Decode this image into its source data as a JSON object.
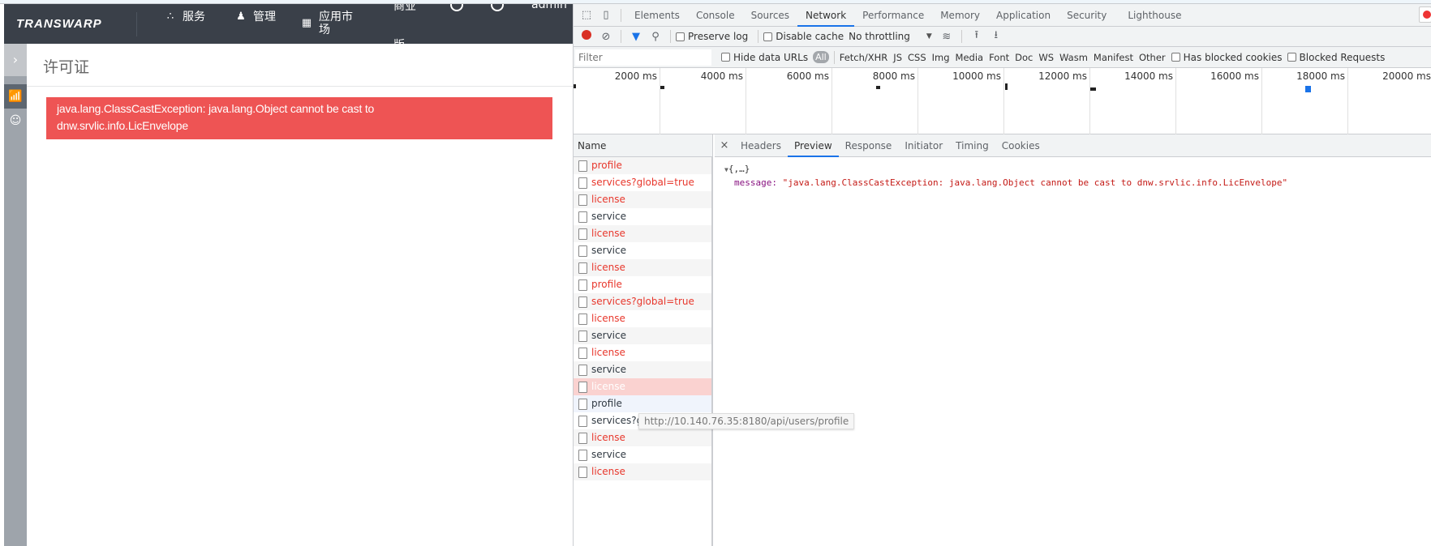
{
  "page": {
    "logo": "TRANSWARP",
    "nav": [
      {
        "icon": "services-icon",
        "glyph": "∴",
        "label": "服务"
      },
      {
        "icon": "user-icon",
        "glyph": "♟",
        "label": "管理"
      },
      {
        "icon": "app-market-icon",
        "glyph": "▦",
        "label": "应用市场"
      }
    ],
    "header_cut_top": "商业",
    "header_cut_bottom": "版",
    "user": "admin",
    "sidebar_expand": "›",
    "page_title": "许可证",
    "alert_line1": "java.lang.ClassCastException: java.lang.Object cannot be cast to",
    "alert_line2": "dnw.srvlic.info.LicEnvelope",
    "alert_color": "#ee5454"
  },
  "devtools": {
    "tabs": [
      "Elements",
      "Console",
      "Sources",
      "Network",
      "Performance",
      "Memory",
      "Application",
      "Security",
      "Lighthouse"
    ],
    "active_tab": "Network",
    "toolbar": {
      "preserve_log": "Preserve log",
      "disable_cache": "Disable cache",
      "throttling": "No throttling"
    },
    "filter": {
      "placeholder": "Filter",
      "hide_data_urls": "Hide data URLs",
      "all": "All",
      "types": [
        "Fetch/XHR",
        "JS",
        "CSS",
        "Img",
        "Media",
        "Font",
        "Doc",
        "WS",
        "Wasm",
        "Manifest",
        "Other"
      ],
      "has_blocked_cookies": "Has blocked cookies",
      "blocked_requests": "Blocked Requests"
    },
    "overview_ticks": [
      "2000 ms",
      "4000 ms",
      "6000 ms",
      "8000 ms",
      "10000 ms",
      "12000 ms",
      "14000 ms",
      "16000 ms",
      "18000 ms",
      "20000 ms"
    ],
    "name_header": "Name",
    "requests": [
      {
        "name": "profile",
        "error": true
      },
      {
        "name": "services?global=true",
        "error": true
      },
      {
        "name": "license",
        "error": true
      },
      {
        "name": "service",
        "error": false
      },
      {
        "name": "license",
        "error": true
      },
      {
        "name": "service",
        "error": false
      },
      {
        "name": "license",
        "error": true
      },
      {
        "name": "profile",
        "error": true
      },
      {
        "name": "services?global=true",
        "error": true
      },
      {
        "name": "license",
        "error": true
      },
      {
        "name": "service",
        "error": false
      },
      {
        "name": "license",
        "error": true
      },
      {
        "name": "service",
        "error": false
      },
      {
        "name": "license",
        "error": true,
        "selected": true
      },
      {
        "name": "profile",
        "error": false,
        "hover": true
      },
      {
        "name": "services?global=true",
        "error": false
      },
      {
        "name": "license",
        "error": true
      },
      {
        "name": "service",
        "error": false
      },
      {
        "name": "license",
        "error": true
      }
    ],
    "tooltip": "http://10.140.76.35:8180/api/users/profile",
    "detail_tabs": [
      "Headers",
      "Preview",
      "Response",
      "Initiator",
      "Timing",
      "Cookies"
    ],
    "active_detail_tab": "Preview",
    "preview": {
      "root": "{,…}",
      "key": "message",
      "value": "\"java.lang.ClassCastException: java.lang.Object cannot be cast to dnw.srvlic.info.LicEnvelope\""
    }
  }
}
